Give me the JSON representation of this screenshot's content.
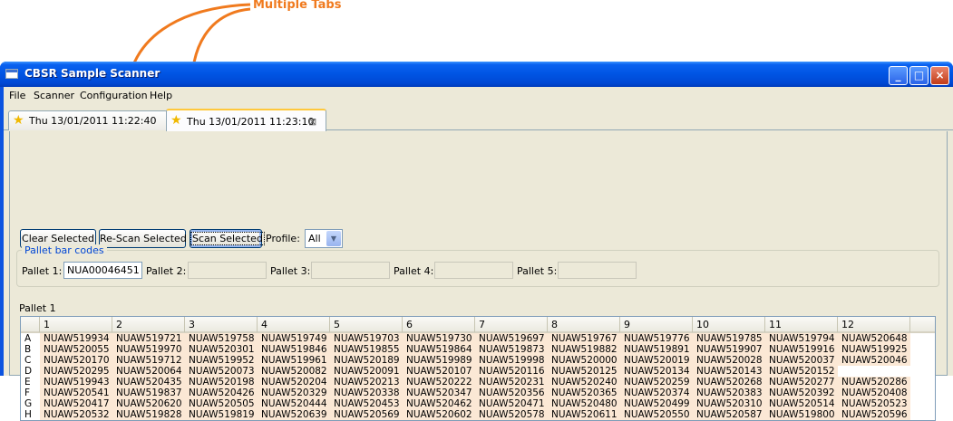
{
  "annotation": {
    "label": "Multiple Tabs"
  },
  "window": {
    "title": "CBSR Sample Scanner"
  },
  "menu": [
    "File",
    "Scanner",
    "Configuration",
    "Help"
  ],
  "tabs": [
    {
      "label": "Thu 13/01/2011 11:22:40"
    },
    {
      "label": "Thu 13/01/2011 11:23:10"
    }
  ],
  "toolbar": {
    "clear_label": "Clear Selected",
    "rescan_label": "Re-Scan Selected",
    "scan_label": "Scan Selected",
    "profile_label": "Profile:",
    "profile_value": "All"
  },
  "pallet_group": {
    "title": "Pallet bar codes",
    "fields": [
      {
        "label": "Pallet 1:",
        "value": "NUA00046451"
      },
      {
        "label": "Pallet 2:",
        "value": ""
      },
      {
        "label": "Pallet 3:",
        "value": ""
      },
      {
        "label": "Pallet 4:",
        "value": ""
      },
      {
        "label": "Pallet 5:",
        "value": ""
      }
    ]
  },
  "table": {
    "title": "Pallet 1",
    "columns": [
      "",
      "1",
      "2",
      "3",
      "4",
      "5",
      "6",
      "7",
      "8",
      "9",
      "10",
      "11",
      "12"
    ],
    "rows": [
      [
        "A",
        "NUAW519934",
        "NUAW519721",
        "NUAW519758",
        "NUAW519749",
        "NUAW519703",
        "NUAW519730",
        "NUAW519697",
        "NUAW519767",
        "NUAW519776",
        "NUAW519785",
        "NUAW519794",
        "NUAW520648"
      ],
      [
        "B",
        "NUAW520055",
        "NUAW519970",
        "NUAW520301",
        "NUAW519846",
        "NUAW519855",
        "NUAW519864",
        "NUAW519873",
        "NUAW519882",
        "NUAW519891",
        "NUAW519907",
        "NUAW519916",
        "NUAW519925"
      ],
      [
        "C",
        "NUAW520170",
        "NUAW519712",
        "NUAW519952",
        "NUAW519961",
        "NUAW520189",
        "NUAW519989",
        "NUAW519998",
        "NUAW520000",
        "NUAW520019",
        "NUAW520028",
        "NUAW520037",
        "NUAW520046"
      ],
      [
        "D",
        "NUAW520295",
        "NUAW520064",
        "NUAW520073",
        "NUAW520082",
        "NUAW520091",
        "NUAW520107",
        "NUAW520116",
        "NUAW520125",
        "NUAW520134",
        "NUAW520143",
        "NUAW520152",
        ""
      ],
      [
        "E",
        "NUAW519943",
        "NUAW520435",
        "NUAW520198",
        "NUAW520204",
        "NUAW520213",
        "NUAW520222",
        "NUAW520231",
        "NUAW520240",
        "NUAW520259",
        "NUAW520268",
        "NUAW520277",
        "NUAW520286"
      ],
      [
        "F",
        "NUAW520541",
        "NUAW519837",
        "NUAW520426",
        "NUAW520329",
        "NUAW520338",
        "NUAW520347",
        "NUAW520356",
        "NUAW520365",
        "NUAW520374",
        "NUAW520383",
        "NUAW520392",
        "NUAW520408"
      ],
      [
        "G",
        "NUAW520417",
        "NUAW520620",
        "NUAW520505",
        "NUAW520444",
        "NUAW520453",
        "NUAW520462",
        "NUAW520471",
        "NUAW520480",
        "NUAW520499",
        "NUAW520310",
        "NUAW520514",
        "NUAW520523"
      ],
      [
        "H",
        "NUAW520532",
        "NUAW519828",
        "NUAW519819",
        "NUAW520639",
        "NUAW520569",
        "NUAW520602",
        "NUAW520578",
        "NUAW520611",
        "NUAW520550",
        "NUAW520587",
        "NUAW519800",
        "NUAW520596"
      ]
    ]
  },
  "colors": {
    "annotation": "#f07a1e",
    "titlebar": "#0054e3",
    "cell_fill": "#fbe8d5",
    "group_title": "#0046d5"
  }
}
